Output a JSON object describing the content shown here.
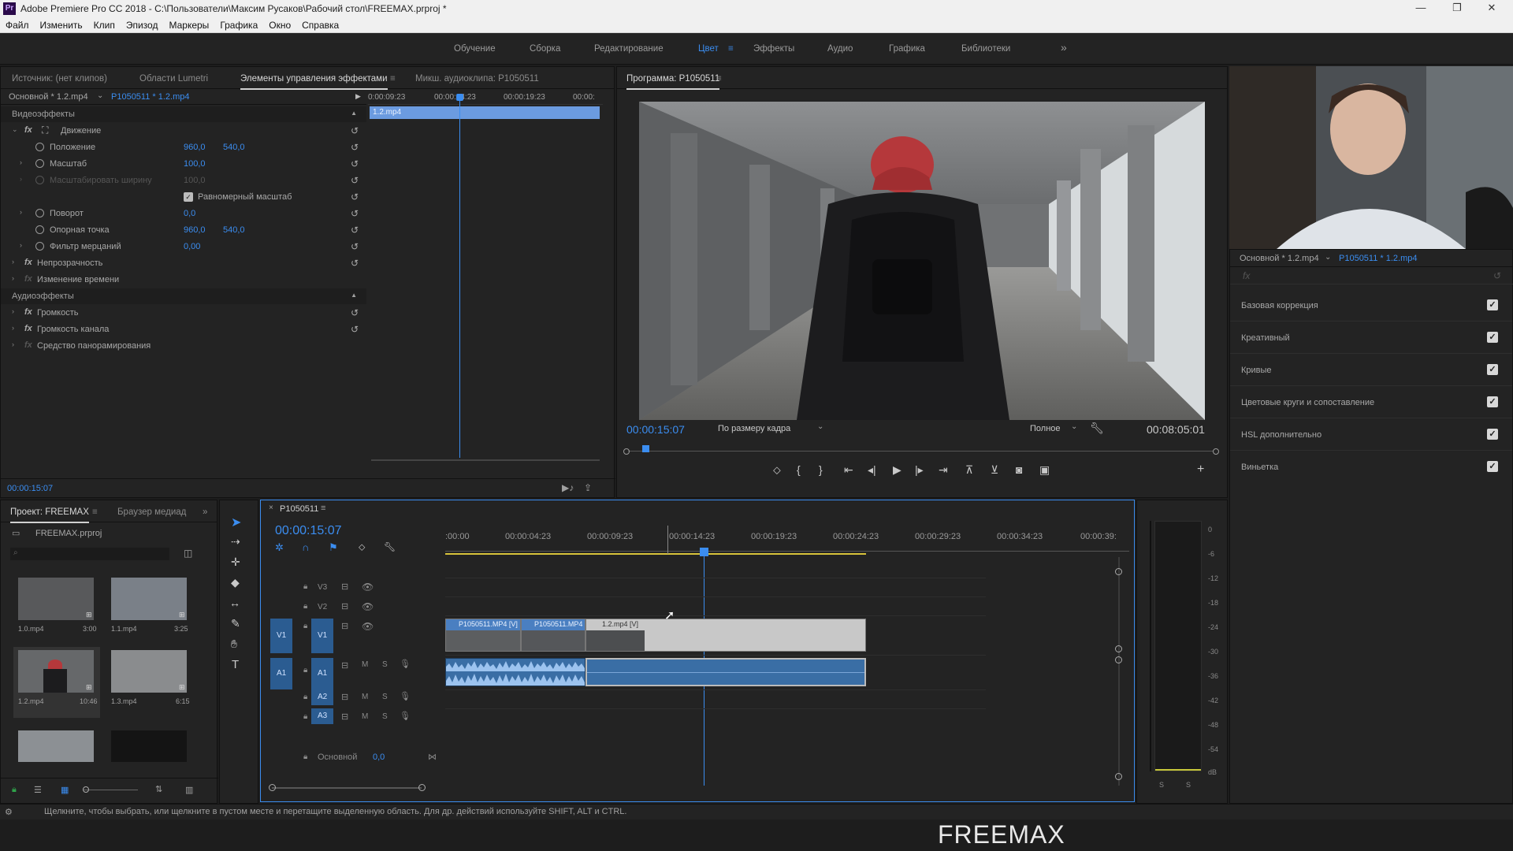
{
  "window": {
    "title": "Adobe Premiere Pro CC 2018 - C:\\Пользователи\\Максим Русаков\\Рабочий стол\\FREEMAX.prproj *",
    "app_badge": "Pr",
    "controls": [
      "—",
      "❐",
      "✕"
    ]
  },
  "menu": [
    "Файл",
    "Изменить",
    "Клип",
    "Эпизод",
    "Маркеры",
    "Графика",
    "Окно",
    "Справка"
  ],
  "workspaces": {
    "tabs": [
      "Обучение",
      "Сборка",
      "Редактирование",
      "Цвет",
      "Эффекты",
      "Аудио",
      "Графика",
      "Библиотеки"
    ],
    "active": "Цвет",
    "more": "»"
  },
  "source_panel": {
    "tabs": [
      "Источник: (нет клипов)",
      "Области Lumetri",
      "Элементы управления эффектами",
      "Микш. аудиоклипа: P1050511"
    ],
    "active_tab": "Элементы управления эффектами",
    "master_clip": "Основной * 1.2.mp4",
    "sequence_clip": "P1050511 * 1.2.mp4",
    "mini_ruler": [
      "0:00:09:23",
      "00:00:14:23",
      "00:00:19:23",
      "00:00:"
    ],
    "mini_clip": "1.2.mp4",
    "video_section": "Видеоэффекты",
    "motion": "Движение",
    "props": [
      {
        "label": "Положение",
        "v1": "960,0",
        "v2": "540,0"
      },
      {
        "label": "Масштаб",
        "v1": "100,0",
        "v2": ""
      },
      {
        "label": "Масштабировать ширину",
        "v1": "100,0",
        "v2": ""
      },
      {
        "label": "Поворот",
        "v1": "0,0",
        "v2": ""
      },
      {
        "label": "Опорная точка",
        "v1": "960,0",
        "v2": "540,0"
      },
      {
        "label": "Фильтр мерцаний",
        "v1": "0,00",
        "v2": ""
      }
    ],
    "uniform_scale": "Равномерный масштаб",
    "opacity": "Непрозрачность",
    "time_remap": "Изменение времени",
    "audio_section": "Аудиоэффекты",
    "audio_props": [
      "Громкость",
      "Громкость канала",
      "Средство панорамирования"
    ],
    "timecode": "00:00:15:07"
  },
  "program_monitor": {
    "title": "Программа: P1050511",
    "timecode": "00:00:15:07",
    "fit": "По размеру кадра",
    "quality": "Полное",
    "duration": "00:08:05:01",
    "playhead_fraction": 0.03
  },
  "lumetri": {
    "master_clip": "Основной * 1.2.mp4",
    "sequence_clip": "P1050511 * 1.2.mp4",
    "fx_label": "fx",
    "sections": [
      "Базовая коррекция",
      "Креативный",
      "Кривые",
      "Цветовые круги и сопоставление",
      "HSL дополнительно",
      "Виньетка"
    ]
  },
  "project": {
    "tabs": [
      "Проект: FREEMAX",
      "Браузер медиад"
    ],
    "file": "FREEMAX.prproj",
    "items": [
      {
        "name": "1.0.mp4",
        "duration": "3:00"
      },
      {
        "name": "1.1.mp4",
        "duration": "3:25"
      },
      {
        "name": "1.2.mp4",
        "duration": "10:46"
      },
      {
        "name": "1.3.mp4",
        "duration": "6:15"
      },
      {
        "name": "",
        "duration": ""
      },
      {
        "name": "",
        "duration": ""
      }
    ]
  },
  "timeline": {
    "sequence": "P1050511",
    "timecode": "00:00:15:07",
    "ruler": [
      ":00:00",
      "00:00:04:23",
      "00:00:09:23",
      "00:00:14:23",
      "00:00:19:23",
      "00:00:24:23",
      "00:00:29:23",
      "00:00:34:23",
      "00:00:39:"
    ],
    "tracks_video": [
      "V3",
      "V2",
      "V1"
    ],
    "tracks_audio": [
      "A1",
      "A2",
      "A3"
    ],
    "source_v": "V1",
    "source_a": "A1",
    "master_label": "Основной",
    "master_value": "0,0",
    "clips": [
      "P1050511.MP4 [V]",
      "P1050511.MP4",
      "1.2.mp4 [V]"
    ],
    "track_m": "M",
    "track_s": "S"
  },
  "audio_meter": {
    "ticks": [
      "0",
      "-6",
      "-12",
      "-18",
      "-24",
      "-30",
      "-36",
      "-42",
      "-48",
      "-54",
      "dB"
    ],
    "solo": [
      "S",
      "S"
    ]
  },
  "status": "Щелкните, чтобы выбрать, или щелкните в пустом месте и перетащите выделенную область. Для др. действий используйте SHIFT, ALT и CTRL.",
  "brand": "FREEMAX",
  "colors": {
    "accent": "#3b8df0",
    "panel": "#232323",
    "bg": "#1d1d1d"
  }
}
